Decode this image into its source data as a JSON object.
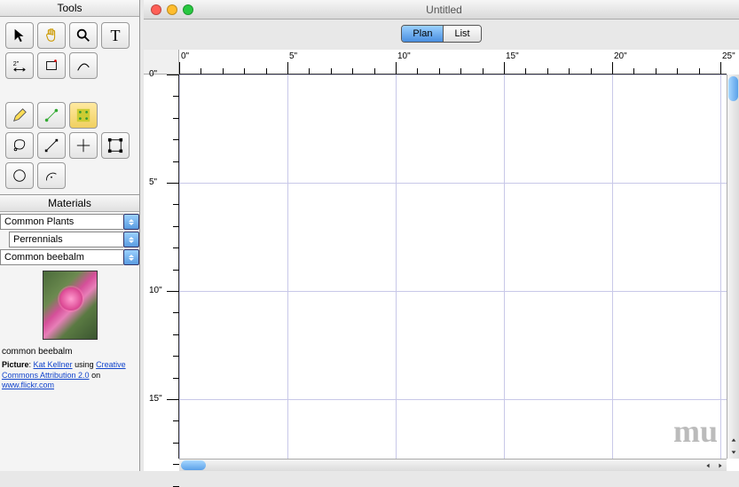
{
  "window": {
    "title": "Untitled"
  },
  "panels": {
    "tools_title": "Tools",
    "materials_title": "Materials"
  },
  "mode_tabs": {
    "plan": "Plan",
    "list": "List"
  },
  "materials": {
    "category": "Common Plants",
    "subcategory": "Perrennials",
    "plant_name": "Common beebalm",
    "caption": "common beebalm",
    "credit_label": "Picture",
    "credit_author": "Kat Kellner",
    "credit_using": " using ",
    "credit_license": "Creative Commons Attribution 2.0",
    "credit_on": " on ",
    "credit_site": "www.flickr.com"
  },
  "ruler": {
    "h_majors": [
      "0\"",
      "5\"",
      "10\"",
      "15\"",
      "20\"",
      "25\""
    ],
    "v_majors": [
      "0\"",
      "5\"",
      "10\"",
      "15\""
    ],
    "major_spacing_px": 122,
    "minor_per_major": 5
  },
  "watermark": "mu"
}
